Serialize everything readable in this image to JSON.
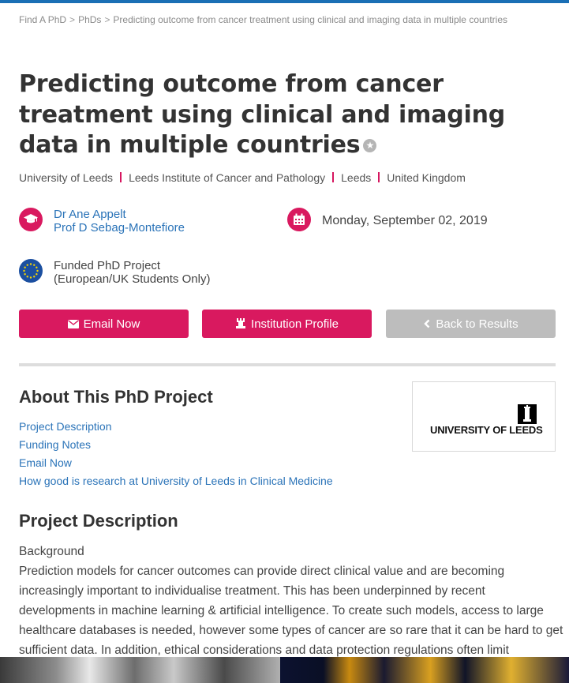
{
  "breadcrumb": {
    "items": [
      "Find A PhD",
      "PhDs",
      "Predicting outcome from cancer treatment using clinical and imaging data in multiple countries"
    ],
    "separator": ">"
  },
  "title": "Predicting outcome from cancer treatment using clinical and imaging data in multiple countries",
  "locations": [
    "University of Leeds",
    "Leeds Institute of Cancer and Pathology",
    "Leeds",
    "United Kingdom"
  ],
  "supervisors": [
    "Dr Ane Appelt",
    "Prof D Sebag-Montefiore"
  ],
  "date": "Monday, September 02, 2019",
  "funding": {
    "line1": "Funded PhD Project",
    "line2": "(European/UK Students Only)"
  },
  "buttons": {
    "email": "Email Now",
    "institution": "Institution Profile",
    "back": "Back to Results"
  },
  "about": {
    "heading": "About This PhD Project",
    "links": [
      "Project Description",
      "Funding Notes",
      "Email Now",
      "How good is research at University of Leeds in Clinical Medicine"
    ]
  },
  "logo": {
    "text": "UNIVERSITY OF LEEDS"
  },
  "project": {
    "heading": "Project Description",
    "subheading": "Background",
    "text": "Prediction models for cancer outcomes can provide direct clinical value and are becoming increasingly important to individualise treatment. This has been underpinned by recent developments in machine learning & artificial intelligence. To create such models, access to large healthcare databases is needed, however some types of cancer are so rare that it can be hard to get sufficient data. In addition, ethical considerations and data protection regulations often limit"
  },
  "colors": {
    "accent": "#d9195f",
    "link": "#2a73b8",
    "top_bar": "#1a6fb5",
    "eu_blue": "#1b4fa0",
    "back_button": "#bdbdbd"
  },
  "icons": {
    "graduation": "graduation-cap-icon",
    "calendar": "calendar-icon",
    "eu_flag": "eu-flag-icon",
    "envelope": "envelope-icon",
    "institution": "institution-icon",
    "back": "chevron-left-icon",
    "star": "star-icon"
  }
}
